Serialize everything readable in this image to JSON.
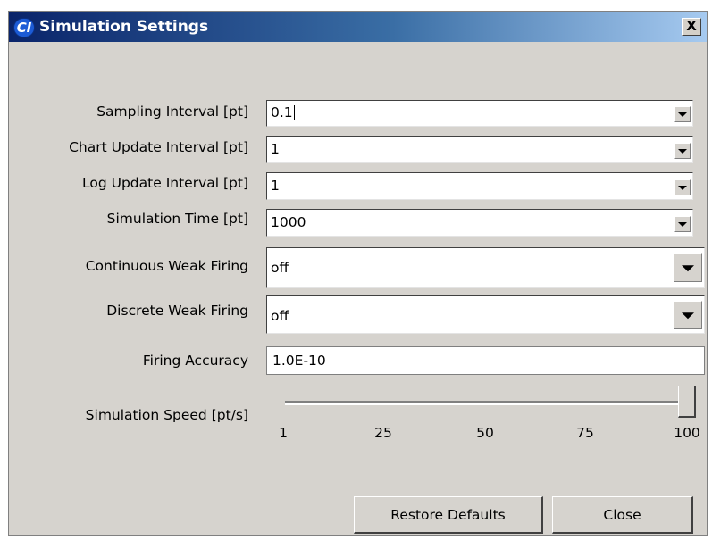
{
  "window": {
    "title": "Simulation Settings",
    "app_icon_text": "CI",
    "close_glyph": "X"
  },
  "fields": [
    {
      "label": "Sampling Interval [pt]",
      "value": "0.1"
    },
    {
      "label": "Chart Update Interval [pt]",
      "value": "1"
    },
    {
      "label": "Log Update Interval [pt]",
      "value": "1"
    },
    {
      "label": "Simulation Time [pt]",
      "value": "1000"
    },
    {
      "label": "Continuous Weak Firing",
      "value": "off"
    },
    {
      "label": "Discrete Weak Firing",
      "value": "off"
    },
    {
      "label": "Firing Accuracy",
      "value": "1.0E-10"
    }
  ],
  "speed": {
    "label": "Simulation Speed [pt/s]",
    "ticks": [
      "1",
      "25",
      "50",
      "75",
      "100"
    ],
    "value": 100
  },
  "buttons": {
    "restore": "Restore Defaults",
    "close": "Close"
  }
}
